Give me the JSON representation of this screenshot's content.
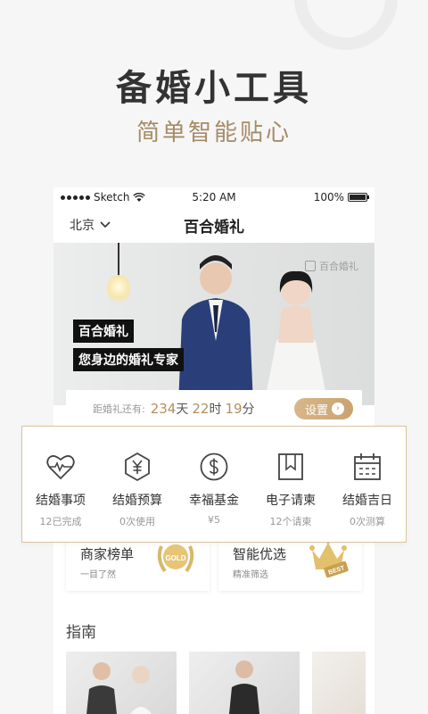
{
  "promo": {
    "headline": "备婚小工具",
    "subline": "简单智能贴心"
  },
  "statusbar": {
    "carrier": "Sketch",
    "time": "5:20 AM",
    "battery": "100%"
  },
  "navbar": {
    "city": "北京",
    "title": "百合婚礼"
  },
  "banner": {
    "brand": "百合婚礼",
    "tag_line1": "百合婚礼",
    "tag_line2": "您身边的婚礼专家"
  },
  "countdown": {
    "label": "距婚礼还有:",
    "days": "234",
    "days_unit": "天",
    "hours": "22",
    "hours_unit": "时",
    "minutes": "19",
    "minutes_unit": "分",
    "button": "设置"
  },
  "tools": [
    {
      "label": "结婚事项",
      "sub": "12已完成",
      "icon": "heartbeat-heart-icon"
    },
    {
      "label": "结婚预算",
      "sub": "0次使用",
      "icon": "yuan-hexagon-icon"
    },
    {
      "label": "幸福基金",
      "sub": "¥5",
      "icon": "dollar-circle-icon"
    },
    {
      "label": "电子请柬",
      "sub": "12个请柬",
      "icon": "bookmark-invite-icon"
    },
    {
      "label": "结婚吉日",
      "sub": "0次测算",
      "icon": "calendar-icon"
    }
  ],
  "cards": [
    {
      "title": "商家榜单",
      "sub": "一目了然",
      "badge": "GOLD"
    },
    {
      "title": "智能优选",
      "sub": "精准筛选",
      "badge": "BEST"
    }
  ],
  "guide": {
    "title": "指南"
  },
  "colors": {
    "accent_gold": "#c9a36f",
    "subline_gold": "#a58b67",
    "tools_border": "#d9c3a0"
  }
}
